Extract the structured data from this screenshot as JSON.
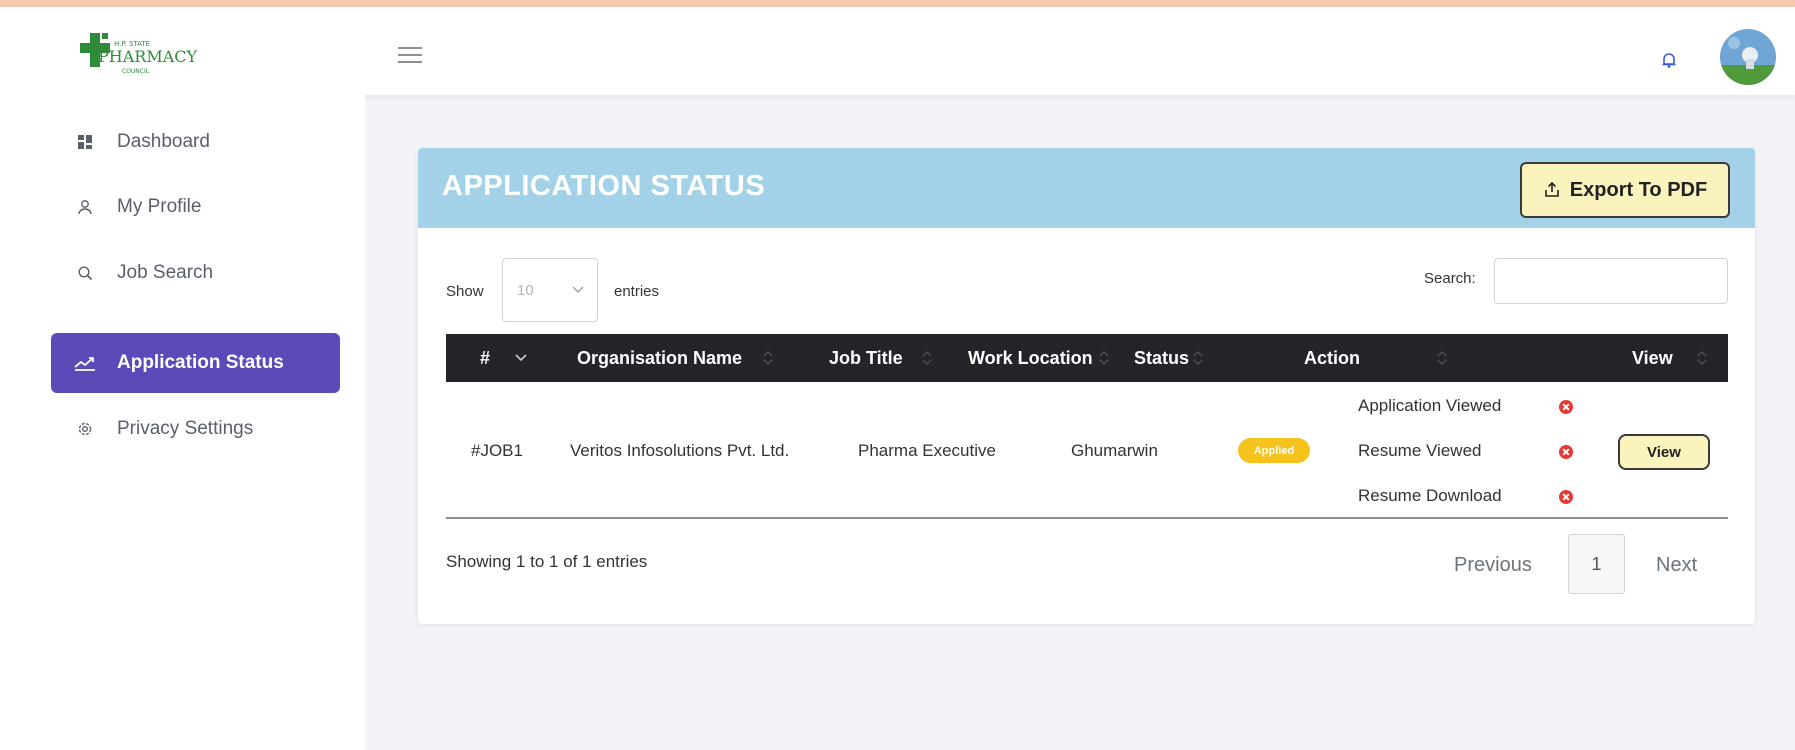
{
  "logo": {
    "text_top": "H.P. STATE",
    "text_main": "PHARMACY",
    "text_bottom": "COUNCIL"
  },
  "header": {
    "menu_icon": "hamburger-menu-icon",
    "notification_icon": "bell-icon",
    "avatar_icon": "user-avatar"
  },
  "sidebar": {
    "items": [
      {
        "label": "Dashboard",
        "icon": "dashboard-grid-icon",
        "active": false
      },
      {
        "label": "My Profile",
        "icon": "user-icon",
        "active": false
      },
      {
        "label": "Job Search",
        "icon": "search-icon",
        "active": false
      },
      {
        "label": "Application Status",
        "icon": "chart-line-icon",
        "active": true
      },
      {
        "label": "Privacy Settings",
        "icon": "gear-icon",
        "active": false
      }
    ],
    "active_color": "#5b4bb8"
  },
  "card": {
    "title": "APPLICATION STATUS",
    "header_color": "#a3d2e8",
    "export_label": "Export To PDF",
    "export_icon": "upload-icon"
  },
  "controls": {
    "show_label": "Show",
    "length_value": "10",
    "entries_label": "entries",
    "search_label": "Search:",
    "search_value": ""
  },
  "table": {
    "columns": [
      "#",
      "Organisation Name",
      "Job Title",
      "Work Location",
      "Status",
      "Action",
      "View"
    ],
    "rows": [
      {
        "id": "#JOB1",
        "organisation": "Veritos Infosolutions Pvt. Ltd.",
        "job_title": "Pharma Executive",
        "location": "Ghumarwin",
        "status": "Applied",
        "actions": [
          "Application Viewed",
          "Resume Viewed",
          "Resume Download"
        ],
        "action_icon": "x-circle-icon",
        "view_label": "View"
      }
    ]
  },
  "footer": {
    "info": "Showing 1 to 1 of 1 entries",
    "previous": "Previous",
    "page": "1",
    "next": "Next"
  }
}
